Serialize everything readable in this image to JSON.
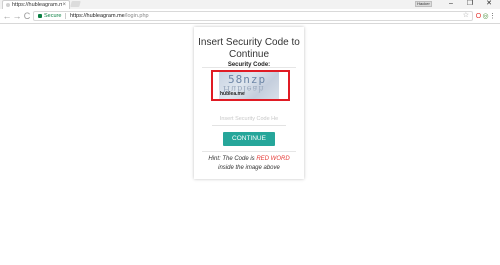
{
  "browser": {
    "tab_title": "https://hubleagram.me",
    "tab_close": "×",
    "window_user": "Hacker",
    "window_controls": [
      "–",
      "❐",
      "✕"
    ],
    "back": "←",
    "forward": "→",
    "reload": "C",
    "secure_label": "Secure",
    "url_host": "https://hubleagram.me",
    "url_path": "/login.php",
    "star": "☆",
    "extensions": [
      "O",
      "◎",
      "●",
      "✦",
      "⋮"
    ]
  },
  "card": {
    "title": "Insert Security Code to Continue",
    "security_label": "Security Code:",
    "captcha_text": "58nzp",
    "captcha_text_mirrored": "Hubleah",
    "captcha_domain": "hublea.me",
    "input_placeholder": "Insert Security Code He",
    "continue_label": "CONTINUE",
    "hint_prefix": "Hint: The Code is ",
    "hint_red": "RED WORD",
    "hint_suffix": " inside the image above"
  },
  "colors": {
    "accent": "#26a69a",
    "highlight": "#e01b24",
    "secure": "#0b8043"
  }
}
